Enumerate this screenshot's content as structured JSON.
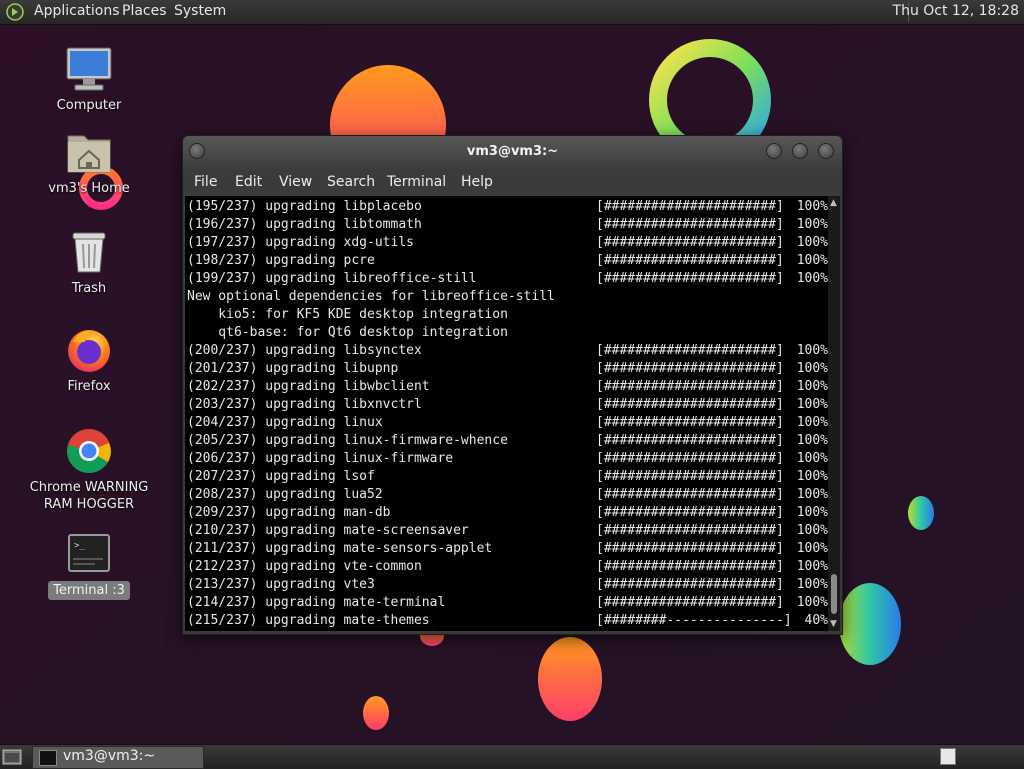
{
  "top_panel": {
    "menus": [
      "Applications",
      "Places",
      "System"
    ],
    "clock": "Thu Oct 12, 18:28"
  },
  "desktop_icons": [
    {
      "label": "Computer",
      "icon": "computer-icon"
    },
    {
      "label": "vm3's Home",
      "icon": "home-folder-icon"
    },
    {
      "label": "Trash",
      "icon": "trash-icon"
    },
    {
      "label": "Firefox",
      "icon": "firefox-icon"
    },
    {
      "label": "Chrome WARNING RAM HOGGER",
      "icon": "chrome-icon"
    },
    {
      "label": "Terminal :3",
      "icon": "terminal-icon",
      "selected": true
    }
  ],
  "terminal": {
    "title": "vm3@vm3:~",
    "menus": [
      "File",
      "Edit",
      "View",
      "Search",
      "Terminal",
      "Help"
    ],
    "lines": [
      {
        "text": "(195/237) upgrading libplacebo",
        "bar": "[######################]",
        "pct": "100%"
      },
      {
        "text": "(196/237) upgrading libtommath",
        "bar": "[######################]",
        "pct": "100%"
      },
      {
        "text": "(197/237) upgrading xdg-utils",
        "bar": "[######################]",
        "pct": "100%"
      },
      {
        "text": "(198/237) upgrading pcre",
        "bar": "[######################]",
        "pct": "100%"
      },
      {
        "text": "(199/237) upgrading libreoffice-still",
        "bar": "[######################]",
        "pct": "100%"
      },
      {
        "text": "New optional dependencies for libreoffice-still",
        "bar": "",
        "pct": ""
      },
      {
        "text": "    kio5: for KF5 KDE desktop integration",
        "bar": "",
        "pct": ""
      },
      {
        "text": "    qt6-base: for Qt6 desktop integration",
        "bar": "",
        "pct": ""
      },
      {
        "text": "(200/237) upgrading libsynctex",
        "bar": "[######################]",
        "pct": "100%"
      },
      {
        "text": "(201/237) upgrading libupnp",
        "bar": "[######################]",
        "pct": "100%"
      },
      {
        "text": "(202/237) upgrading libwbclient",
        "bar": "[######################]",
        "pct": "100%"
      },
      {
        "text": "(203/237) upgrading libxnvctrl",
        "bar": "[######################]",
        "pct": "100%"
      },
      {
        "text": "(204/237) upgrading linux",
        "bar": "[######################]",
        "pct": "100%"
      },
      {
        "text": "(205/237) upgrading linux-firmware-whence",
        "bar": "[######################]",
        "pct": "100%"
      },
      {
        "text": "(206/237) upgrading linux-firmware",
        "bar": "[######################]",
        "pct": "100%"
      },
      {
        "text": "(207/237) upgrading lsof",
        "bar": "[######################]",
        "pct": "100%"
      },
      {
        "text": "(208/237) upgrading lua52",
        "bar": "[######################]",
        "pct": "100%"
      },
      {
        "text": "(209/237) upgrading man-db",
        "bar": "[######################]",
        "pct": "100%"
      },
      {
        "text": "(210/237) upgrading mate-screensaver",
        "bar": "[######################]",
        "pct": "100%"
      },
      {
        "text": "(211/237) upgrading mate-sensors-applet",
        "bar": "[######################]",
        "pct": "100%"
      },
      {
        "text": "(212/237) upgrading vte-common",
        "bar": "[######################]",
        "pct": "100%"
      },
      {
        "text": "(213/237) upgrading vte3",
        "bar": "[######################]",
        "pct": "100%"
      },
      {
        "text": "(214/237) upgrading mate-terminal",
        "bar": "[######################]",
        "pct": "100%"
      },
      {
        "text": "(215/237) upgrading mate-themes",
        "bar": "[########---------------]",
        "pct": "40%"
      }
    ]
  },
  "taskbar": {
    "window_label": "vm3@vm3:~"
  }
}
